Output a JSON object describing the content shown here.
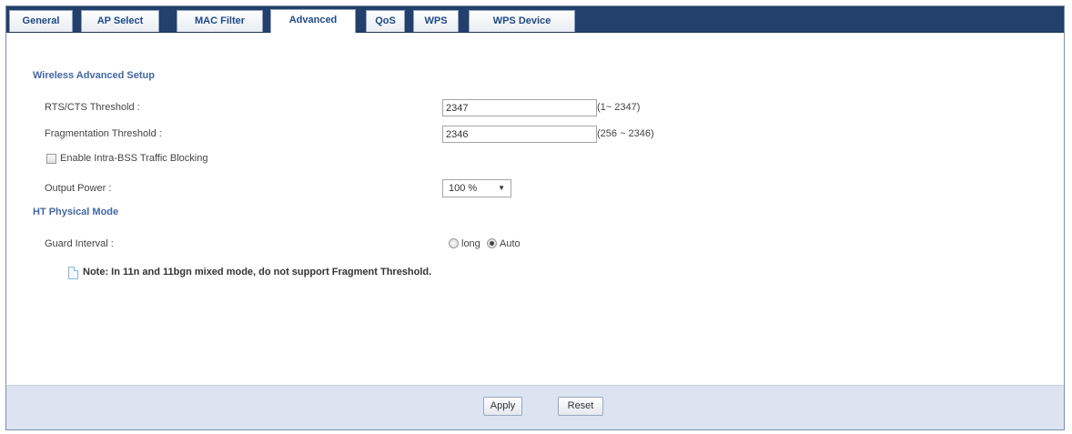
{
  "tabs": [
    {
      "label": "General",
      "active": false
    },
    {
      "label": "AP Select",
      "active": false
    },
    {
      "label": "MAC Filter",
      "active": false
    },
    {
      "label": "Advanced",
      "active": true
    },
    {
      "label": "QoS",
      "active": false
    },
    {
      "label": "WPS",
      "active": false
    },
    {
      "label": "WPS Device",
      "active": false
    }
  ],
  "wireless_advanced": {
    "title": "Wireless Advanced Setup",
    "rts_label": "RTS/CTS Threshold :",
    "rts_value": "2347",
    "rts_range": "(1~ 2347)",
    "frag_label": "Fragmentation Threshold :",
    "frag_value": "2346",
    "frag_range": "(256 ~ 2346)",
    "intra_bss_label": "Enable Intra-BSS Traffic Blocking",
    "intra_bss_checked": false,
    "output_power_label": "Output Power :",
    "output_power_value": "100 %"
  },
  "ht_physical": {
    "title": "HT Physical Mode",
    "guard_interval_label": "Guard Interval :",
    "option_long": "long",
    "option_auto": "Auto",
    "selected": "Auto"
  },
  "note": "Note: In 11n and 11bgn mixed mode, do not support Fragment Threshold.",
  "buttons": {
    "apply": "Apply",
    "reset": "Reset"
  },
  "colors": {
    "tabbar": "#233f6b",
    "section_title": "#4267a6",
    "footer": "#dbe4f0"
  },
  "icons": {
    "note": "note-icon",
    "dropdown": "chevron-down-icon"
  }
}
